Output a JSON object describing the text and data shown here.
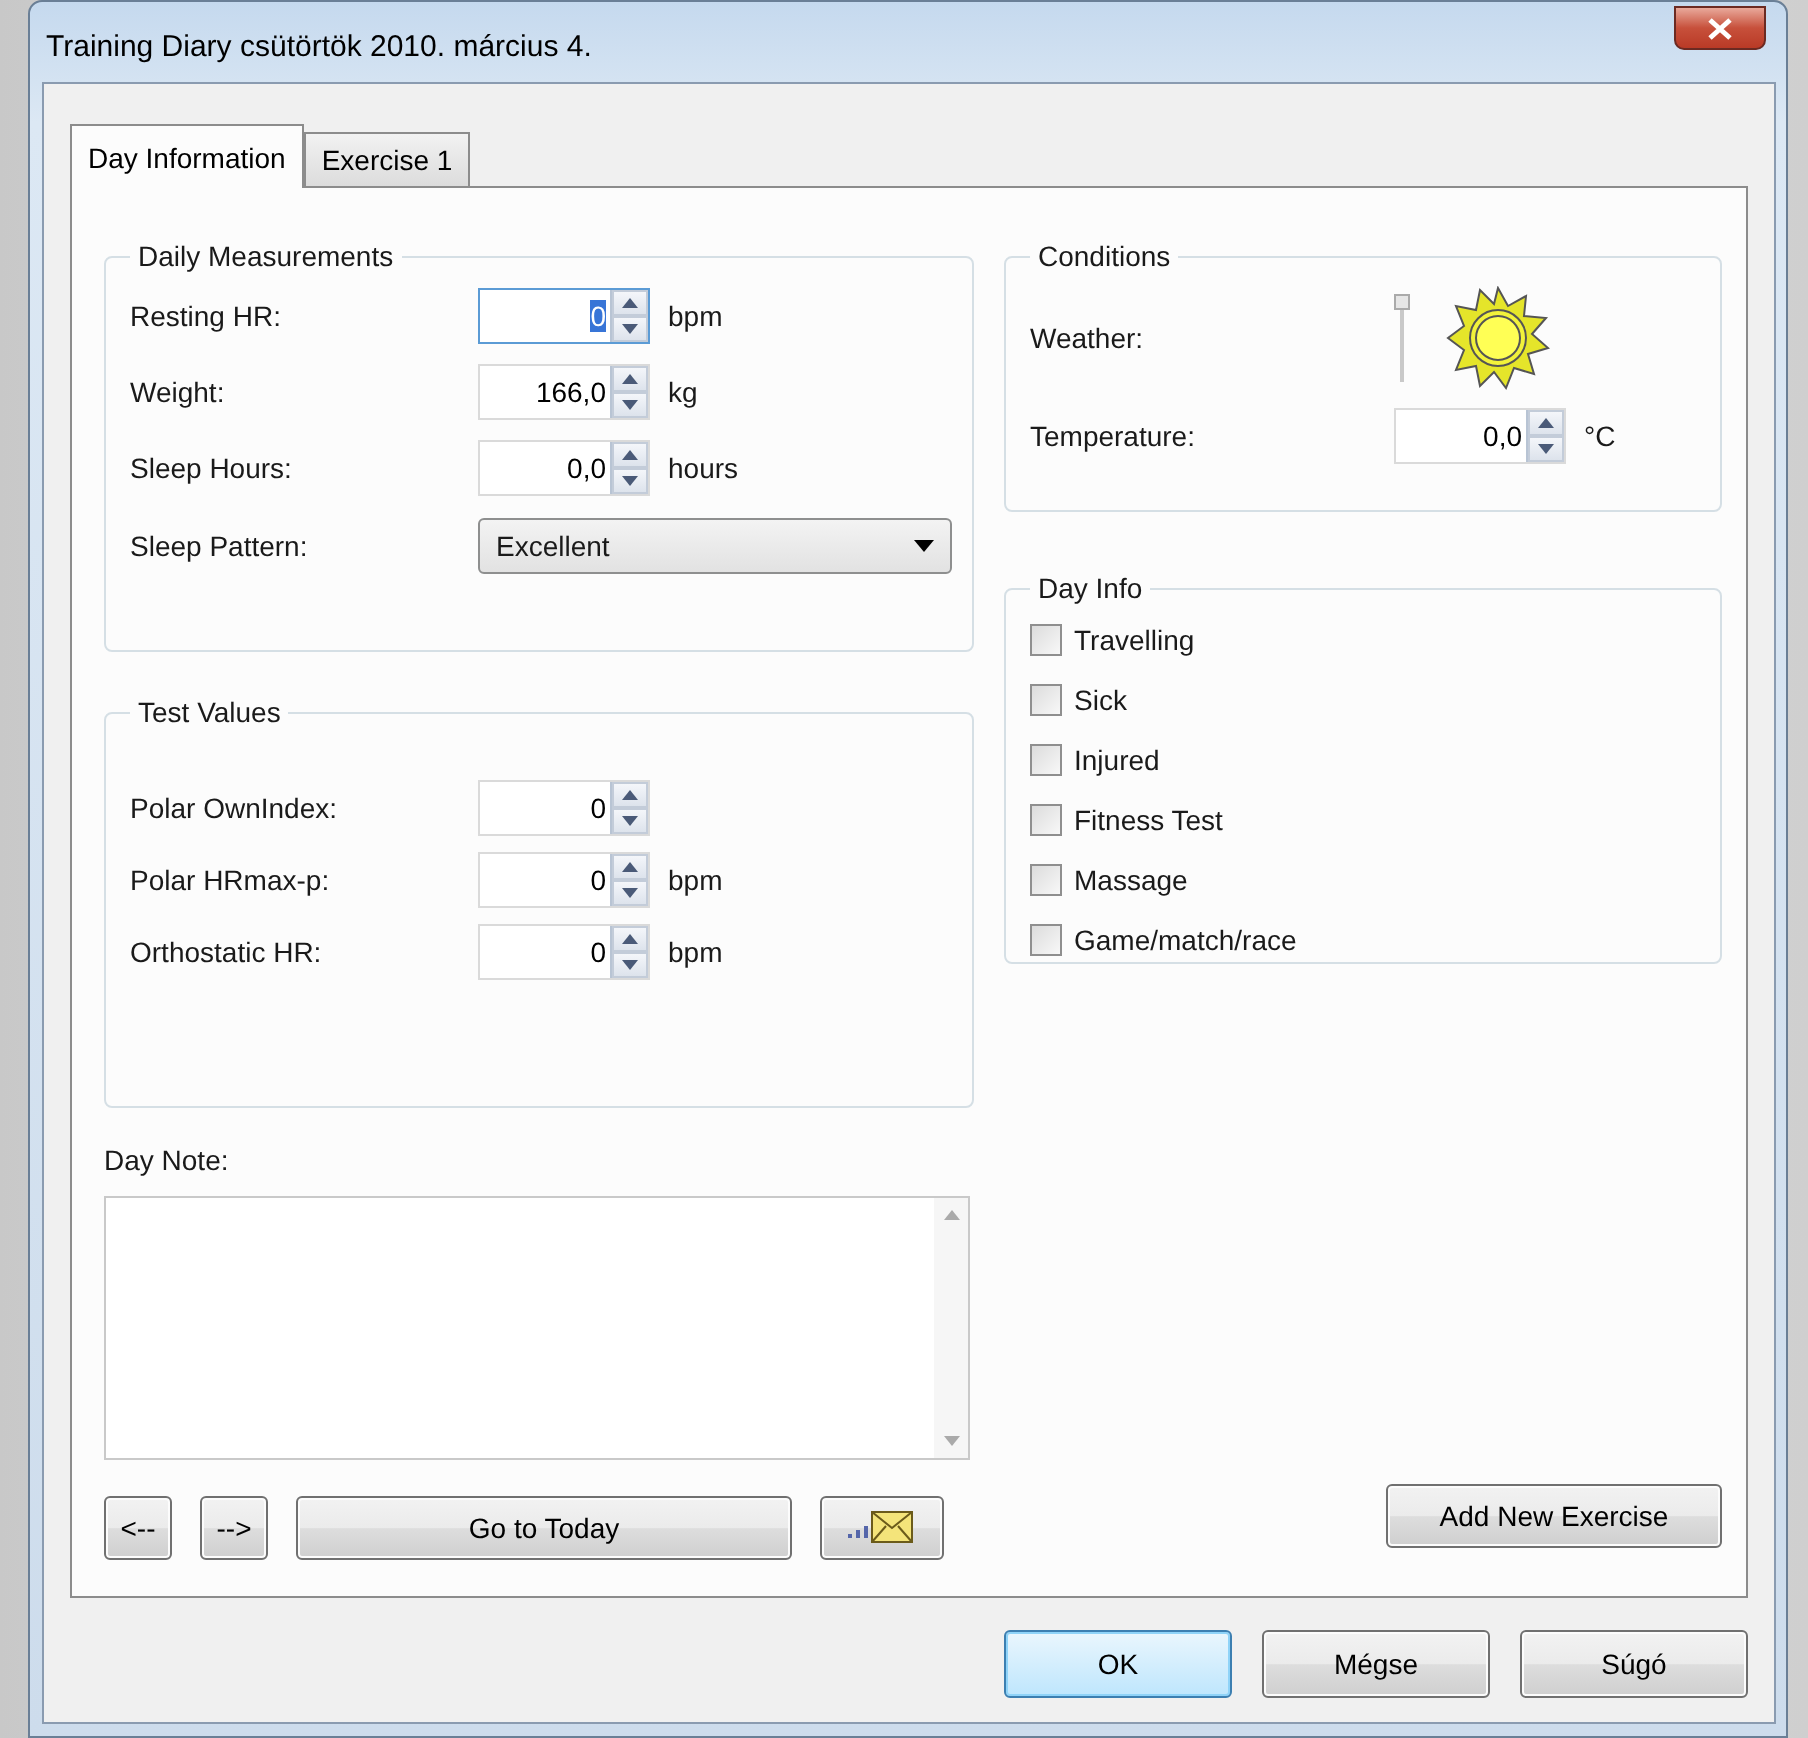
{
  "window": {
    "title": "Training Diary csütörtök 2010. március 4."
  },
  "tabs": [
    {
      "label": "Day Information",
      "selected": true
    },
    {
      "label": "Exercise 1",
      "selected": false
    }
  ],
  "daily_measurements": {
    "title": "Daily Measurements",
    "fields": [
      {
        "label": "Resting HR:",
        "value": "0",
        "unit": "bpm",
        "focused": true
      },
      {
        "label": "Weight:",
        "value": "166,0",
        "unit": "kg",
        "focused": false
      },
      {
        "label": "Sleep Hours:",
        "value": "0,0",
        "unit": "hours",
        "focused": false
      }
    ],
    "sleep_pattern": {
      "label": "Sleep Pattern:",
      "value": "Excellent"
    }
  },
  "test_values": {
    "title": "Test Values",
    "fields": [
      {
        "label": "Polar OwnIndex:",
        "value": "0",
        "focused": false
      },
      {
        "label": "Polar HRmax-p:",
        "value": "0",
        "unit": "bpm",
        "focused": false
      },
      {
        "label": "Orthostatic HR:",
        "value": "0",
        "unit": "bpm",
        "focused": false
      }
    ]
  },
  "day_note": {
    "label": "Day Note:"
  },
  "nav_buttons": [
    "<--",
    "-->"
  ],
  "today_button": "Go to Today",
  "conditions": {
    "title": "Conditions",
    "weather": {
      "label": "Weather:",
      "level": 1
    },
    "temperature": {
      "label": "Temperature:",
      "value": "0,0",
      "unit": "°C",
      "focused": false
    }
  },
  "day_info": {
    "title": "Day Info",
    "items": [
      {
        "label": "Travelling",
        "checked": false
      },
      {
        "label": "Sick",
        "checked": false
      },
      {
        "label": "Injured",
        "checked": false
      },
      {
        "label": "Fitness Test",
        "checked": false
      },
      {
        "label": "Massage",
        "checked": false
      },
      {
        "label": "Game/match/race",
        "checked": false
      }
    ]
  },
  "add_exercise_button": "Add New Exercise",
  "dialog_buttons": [
    {
      "label": "OK",
      "default": true
    },
    {
      "label": "Mégse",
      "default": false
    },
    {
      "label": "Súgó",
      "default": false
    }
  ]
}
